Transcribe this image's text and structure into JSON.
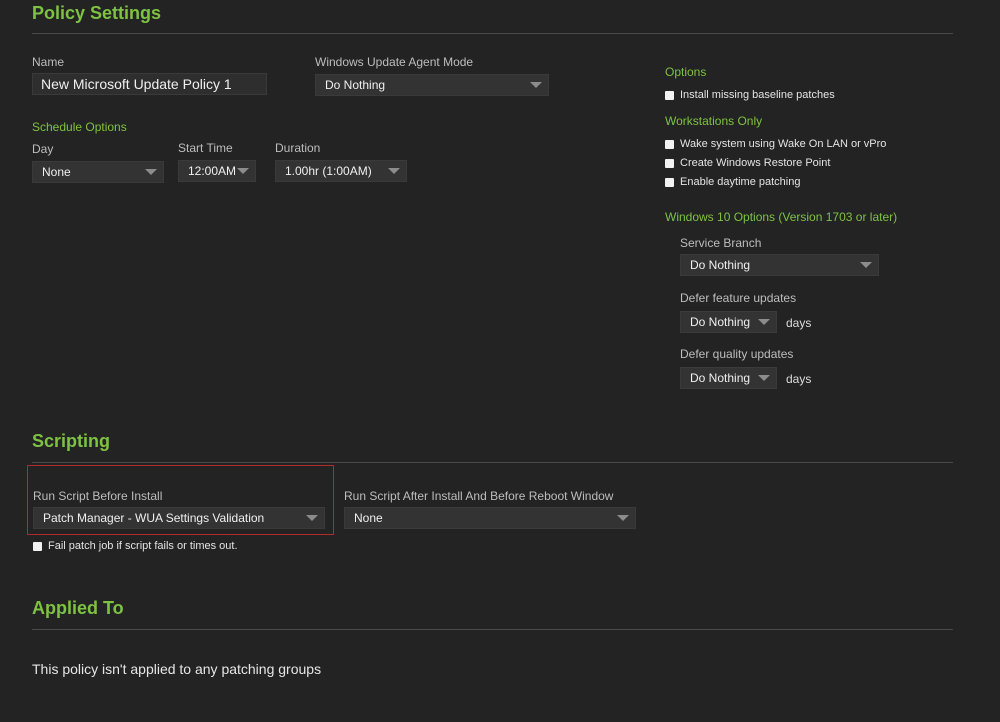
{
  "policy": {
    "title": "Policy Settings",
    "name_label": "Name",
    "name_value": "New Microsoft Update Policy 1",
    "wua_label": "Windows Update Agent Mode",
    "wua_value": "Do Nothing",
    "schedule_title": "Schedule Options",
    "day_label": "Day",
    "day_value": "None",
    "start_label": "Start Time",
    "start_value": "12:00AM",
    "duration_label": "Duration",
    "duration_value": "1.00hr (1:00AM)"
  },
  "options": {
    "title": "Options",
    "install_baseline": "Install missing baseline patches",
    "workstations_title": "Workstations Only",
    "wake_lan": "Wake system using Wake On LAN or vPro",
    "restore_point": "Create Windows Restore Point",
    "daytime_patching": "Enable daytime patching",
    "win10_title": "Windows 10 Options (Version 1703 or later)",
    "service_branch_label": "Service Branch",
    "service_branch_value": "Do Nothing",
    "defer_feature_label": "Defer feature updates",
    "defer_feature_value": "Do Nothing",
    "defer_quality_label": "Defer quality updates",
    "defer_quality_value": "Do Nothing",
    "days_label": "days"
  },
  "scripting": {
    "title": "Scripting",
    "before_label": "Run Script Before Install",
    "before_value": "Patch Manager - WUA Settings Validation",
    "after_label": "Run Script After Install And Before Reboot Window",
    "after_value": "None",
    "fail_label": "Fail patch job if script fails or times out."
  },
  "applied": {
    "title": "Applied To",
    "message": "This policy isn't applied to any patching groups"
  },
  "colors": {
    "background": "#232323",
    "accent": "#7ec242",
    "highlight_border": "#b22a2a"
  }
}
